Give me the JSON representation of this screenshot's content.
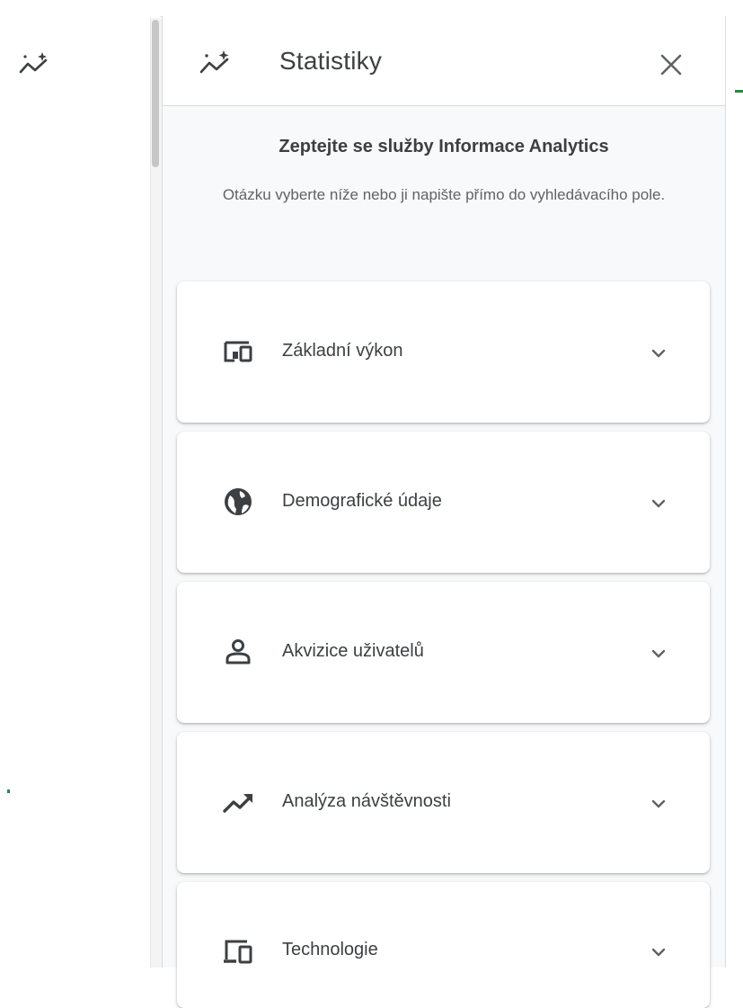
{
  "panel": {
    "title": "Statistiky",
    "header_icon": "insights-sparkle-icon",
    "close_icon": "close-icon"
  },
  "ask": {
    "title": "Zeptejte se služby Informace Analytics",
    "subtitle": "Otázku vyberte níže nebo ji napište přímo do vyhledávacího pole."
  },
  "sections": [
    {
      "label": "Základní výkon",
      "icon": "performance-devices-icon"
    },
    {
      "label": "Demografické údaje",
      "icon": "globe-icon"
    },
    {
      "label": "Akvizice uživatelů",
      "icon": "person-icon"
    },
    {
      "label": "Analýza návštěvnosti",
      "icon": "trending-up-icon"
    },
    {
      "label": "Technologie",
      "icon": "devices-icon"
    }
  ],
  "colors": {
    "text_primary": "#3c4043",
    "text_secondary": "#5f6368",
    "panel_bg": "#f8f9fa",
    "accent_green": "#1e8e3e"
  }
}
